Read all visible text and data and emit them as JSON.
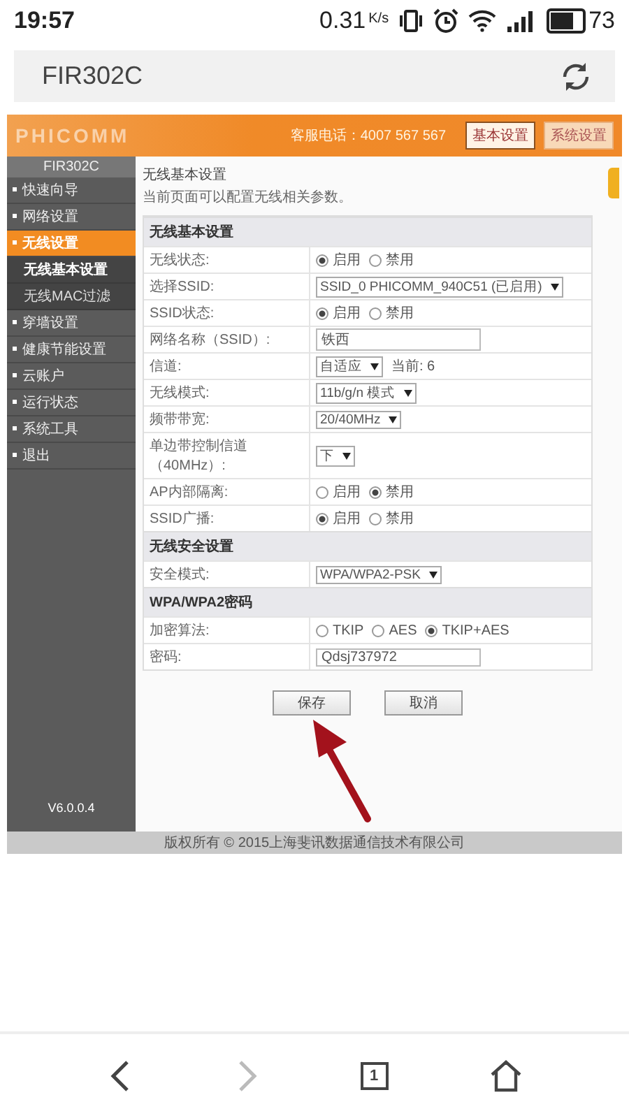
{
  "status_bar": {
    "time": "19:57",
    "speed": "0.31",
    "speed_unit": "K/s",
    "battery": "73"
  },
  "address_bar": {
    "title": "FIR302C"
  },
  "router": {
    "logo": "PHICOMM",
    "hotline": "客服电话：4007 567 567",
    "top_buttons": [
      {
        "label": "基本设置",
        "selected": true
      },
      {
        "label": "系统设置",
        "selected": false
      }
    ],
    "model": "FIR302C",
    "version": "V6.0.0.4",
    "menu": [
      {
        "label": "快速向导",
        "selected": false
      },
      {
        "label": "网络设置",
        "selected": false
      },
      {
        "label": "无线设置",
        "selected": true,
        "children": [
          {
            "label": "无线基本设置",
            "selected": true
          },
          {
            "label": "无线MAC过滤",
            "selected": false
          }
        ]
      },
      {
        "label": "穿墙设置",
        "selected": false
      },
      {
        "label": "健康节能设置",
        "selected": false
      },
      {
        "label": "云账户",
        "selected": false
      },
      {
        "label": "运行状态",
        "selected": false
      },
      {
        "label": "系统工具",
        "selected": false
      },
      {
        "label": "退出",
        "selected": false
      }
    ],
    "page_title": "无线基本设置",
    "page_desc": "当前页面可以配置无线相关参数。",
    "sections": [
      {
        "title": "无线基本设置",
        "rows": [
          {
            "kind": "radio",
            "label": "无线状态:",
            "options": [
              {
                "label": "启用",
                "selected": true
              },
              {
                "label": "禁用",
                "selected": false
              }
            ]
          },
          {
            "kind": "select",
            "label": "选择SSID:",
            "value": "SSID_0 PHICOMM_940C51 (已启用)"
          },
          {
            "kind": "radio",
            "label": "SSID状态:",
            "options": [
              {
                "label": "启用",
                "selected": true
              },
              {
                "label": "禁用",
                "selected": false
              }
            ]
          },
          {
            "kind": "text",
            "label": "网络名称（SSID）:",
            "value": "铁西"
          },
          {
            "kind": "select",
            "label": "信道:",
            "value": "自适应",
            "note": "当前: 6"
          },
          {
            "kind": "select",
            "label": "无线模式:",
            "value": "11b/g/n 模式"
          },
          {
            "kind": "select",
            "label": "频带带宽:",
            "value": "20/40MHz"
          },
          {
            "kind": "select",
            "label": "单边带控制信道（40MHz）:",
            "value": "下"
          },
          {
            "kind": "radio",
            "label": "AP内部隔离:",
            "options": [
              {
                "label": "启用",
                "selected": false
              },
              {
                "label": "禁用",
                "selected": true
              }
            ]
          },
          {
            "kind": "radio",
            "label": "SSID广播:",
            "options": [
              {
                "label": "启用",
                "selected": true
              },
              {
                "label": "禁用",
                "selected": false
              }
            ]
          }
        ]
      },
      {
        "title": "无线安全设置",
        "rows": [
          {
            "kind": "select",
            "label": "安全模式:",
            "value": "WPA/WPA2-PSK"
          }
        ]
      },
      {
        "title": "WPA/WPA2密码",
        "rows": [
          {
            "kind": "radio",
            "label": "加密算法:",
            "options": [
              {
                "label": "TKIP",
                "selected": false
              },
              {
                "label": "AES",
                "selected": false
              },
              {
                "label": "TKIP+AES",
                "selected": true
              }
            ]
          },
          {
            "kind": "text",
            "label": "密码:",
            "value": "Qdsj737972"
          }
        ]
      }
    ],
    "buttons": [
      "保存",
      "取消"
    ],
    "footer": "版权所有 © 2015上海斐讯数据通信技术有限公司"
  },
  "nav": {
    "back_disabled": false,
    "forward_disabled": true,
    "tab_count": "1"
  }
}
